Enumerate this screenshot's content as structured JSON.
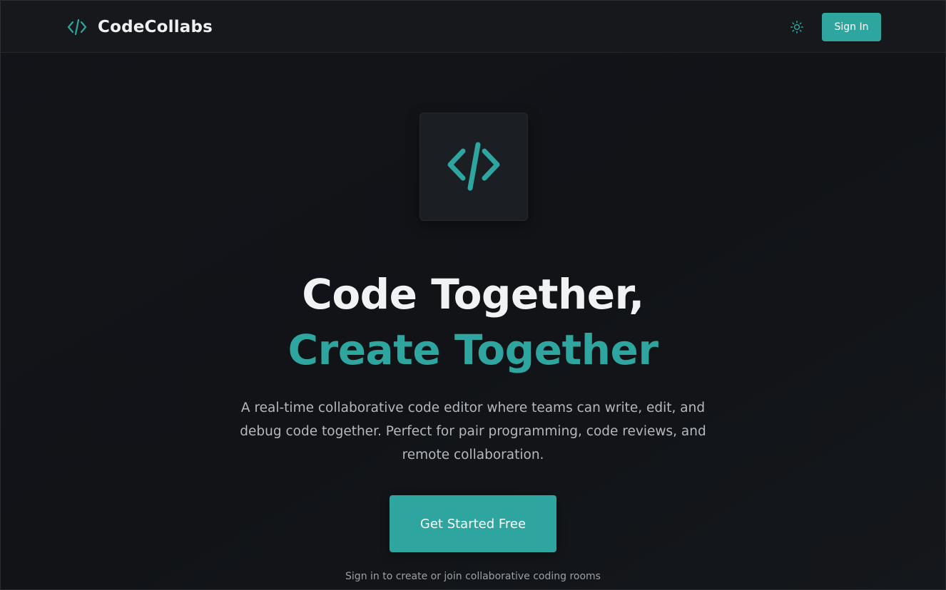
{
  "colors": {
    "accent": "#2ea69f",
    "background": "#121419",
    "navbar": "#16181c",
    "text_primary": "#f1f2f3",
    "text_muted": "#b4b9bf"
  },
  "navbar": {
    "brand_icon": "code-brackets-icon",
    "brand_name": "CodeCollabs",
    "theme_toggle_icon": "sun-icon",
    "signin_label": "Sign In"
  },
  "hero": {
    "icon": "code-brackets-icon",
    "title_line1": "Code Together,",
    "title_line2": "Create Together",
    "description": "A real-time collaborative code editor where teams can write, edit, and debug code together. Perfect for pair programming, code reviews, and remote collaboration.",
    "cta_label": "Get Started Free",
    "footnote": "Sign in to create or join collaborative coding rooms"
  }
}
